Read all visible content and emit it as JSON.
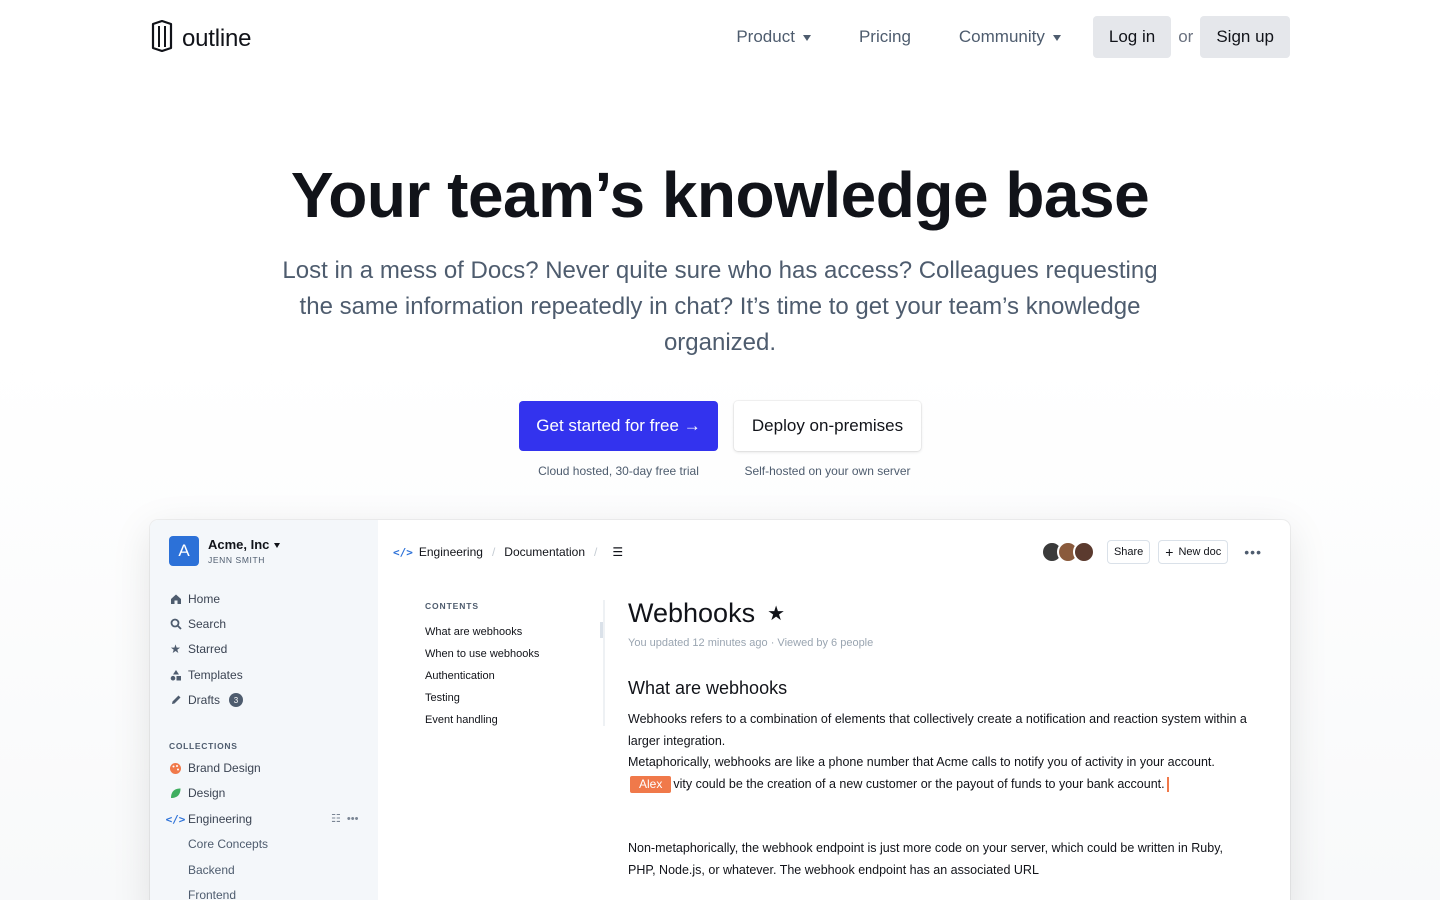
{
  "nav": {
    "brand": "outline",
    "links": [
      {
        "label": "Product",
        "dropdown": true
      },
      {
        "label": "Pricing",
        "dropdown": false
      },
      {
        "label": "Community",
        "dropdown": true
      }
    ],
    "login_label": "Log in",
    "or_label": "or",
    "signup_label": "Sign up"
  },
  "hero": {
    "title": "Your team’s knowledge base",
    "subtitle": "Lost in a mess of Docs? Never quite sure who has access? Colleagues requesting the same information repeatedly in chat? It’s time to get your team’s knowledge organized.",
    "primary_cta": "Get started for free →",
    "primary_note": "Cloud hosted, 30-day free trial",
    "secondary_cta": "Deploy on-premises",
    "secondary_note": "Self-hosted on your own server"
  },
  "app": {
    "team": {
      "initial": "A",
      "name": "Acme, Inc",
      "user": "JENN SMITH"
    },
    "sidebar": {
      "items": [
        {
          "label": "Home",
          "icon": "home-icon"
        },
        {
          "label": "Search",
          "icon": "search-icon"
        },
        {
          "label": "Starred",
          "icon": "star-icon"
        },
        {
          "label": "Templates",
          "icon": "shapes-icon"
        },
        {
          "label": "Drafts",
          "icon": "pencil-icon",
          "badge": "3"
        }
      ],
      "collections_heading": "COLLECTIONS",
      "collections": [
        {
          "label": "Brand Design",
          "color": "#f0794a"
        },
        {
          "label": "Design",
          "color": "#3fae5f"
        },
        {
          "label": "Engineering",
          "color": "#2c71d8"
        }
      ],
      "subitems": [
        "Core Concepts",
        "Backend",
        "Frontend"
      ]
    },
    "breadcrumb": {
      "collection": "Engineering",
      "folder": "Documentation"
    },
    "toolbar": {
      "share_label": "Share",
      "new_doc_label": "New doc"
    },
    "toc": {
      "title": "CONTENTS",
      "items": [
        "What are webhooks",
        "When to use webhooks",
        "Authentication",
        "Testing",
        "Event handling"
      ]
    },
    "doc": {
      "title": "Webhooks",
      "meta": "You updated 12 minutes ago · Viewed by 6 people",
      "heading": "What are webhooks",
      "para1": "Webhooks refers to a combination of elements that collectively create a notification and reaction system within a larger integration.",
      "para2_before": "Metaphorically, webhooks are like a phone number that Acme calls to notify you of activity in your account.",
      "cursor_name": "Alex",
      "para2_after": "vity could be the creation of a new customer or the payout of funds to your bank account.",
      "para3": "Non-metaphorically, the webhook endpoint is just more code on your server, which could be written in Ruby, PHP, Node.js, or whatever. The webhook endpoint has an associated URL"
    },
    "colors": {
      "accent": "#3333ee",
      "cursor": "#f0794a",
      "team_avatar": "#2c71d8"
    }
  }
}
